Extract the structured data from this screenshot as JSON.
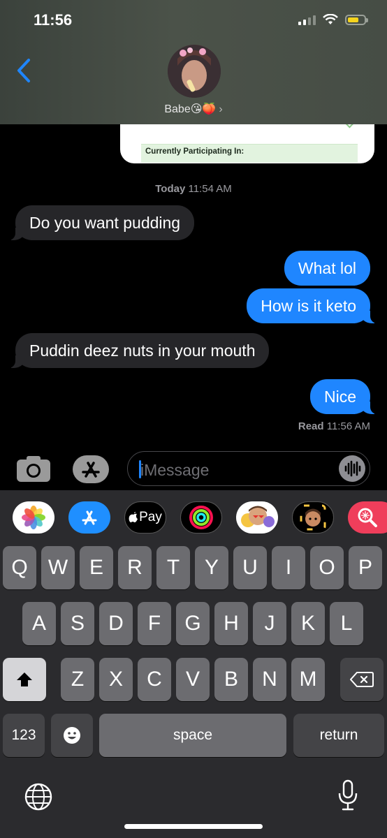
{
  "status_bar": {
    "time": "11:56"
  },
  "header": {
    "contact_name": "Babe😘🍑",
    "chevron": "›"
  },
  "shared_card": {
    "label": "Currently Participating In:"
  },
  "conversation": {
    "timestamp_day": "Today",
    "timestamp_time": "11:54 AM",
    "messages": [
      {
        "direction": "incoming",
        "text": "Do you want pudding"
      },
      {
        "direction": "outgoing",
        "text": "What lol"
      },
      {
        "direction": "outgoing",
        "text": "How is it keto"
      },
      {
        "direction": "incoming",
        "text": "Puddin deez nuts in your mouth"
      },
      {
        "direction": "outgoing",
        "text": "Nice"
      }
    ],
    "read_label": "Read",
    "read_time": "11:56 AM"
  },
  "input_bar": {
    "placeholder": "iMessage"
  },
  "app_strip": {
    "apps": [
      "photos-icon",
      "app-store-icon",
      "apple-pay-icon",
      "activity-icon",
      "memoji-stickers-icon",
      "memoji-icon",
      "image-search-icon"
    ],
    "apple_pay_label": "Pay"
  },
  "keyboard": {
    "row1": [
      "Q",
      "W",
      "E",
      "R",
      "T",
      "Y",
      "U",
      "I",
      "O",
      "P"
    ],
    "row2": [
      "A",
      "S",
      "D",
      "F",
      "G",
      "H",
      "J",
      "K",
      "L"
    ],
    "row3": [
      "Z",
      "X",
      "C",
      "V",
      "B",
      "N",
      "M"
    ],
    "numbers_label": "123",
    "space_label": "space",
    "return_label": "return"
  },
  "colors": {
    "outgoing_bubble": "#1f86ff",
    "incoming_bubble": "#262629",
    "key": "#6c6c70",
    "keyboard_bg": "#2b2b2e"
  }
}
